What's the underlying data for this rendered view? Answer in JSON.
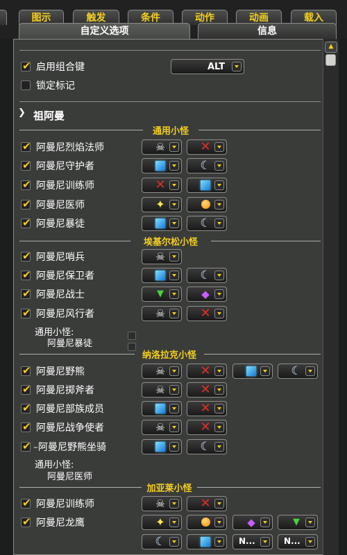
{
  "tabs_top": [
    "图示",
    "触发",
    "条件",
    "动作",
    "动画",
    "载入"
  ],
  "tabs_sub": [
    "自定义选项",
    "信息"
  ],
  "options": {
    "combo_key_label": "启用组合键",
    "combo_key_value": "ALT",
    "lock_label": "锁定标记"
  },
  "boss_name": "祖阿曼",
  "sections": {
    "s1": "通用小怪",
    "s2": "埃基尔松小怪",
    "s3": "纳洛拉克小怪",
    "s4": "加亚莱小怪"
  },
  "rows": {
    "r1": "阿曼尼烈焰法师",
    "r2": "阿曼尼守护者",
    "r3": "阿曼尼训练师",
    "r4": "阿曼尼医师",
    "r5": "阿曼尼暴徒",
    "r6": "阿曼尼哨兵",
    "r7": "阿曼尼保卫者",
    "r8": "阿曼尼战士",
    "r9": "阿曼尼风行者",
    "r10": "阿曼尼野熊",
    "r11": "阿曼尼掷斧者",
    "r12": "阿曼尼部族成员",
    "r13": "阿曼尼战争使者",
    "r14": "阿曼尼野熊坐骑",
    "r15": "阿曼尼训练师",
    "r16": "阿曼尼龙鹰"
  },
  "notes": {
    "n1_title": "通用小怪:",
    "n1_value": "阿曼尼暴徒",
    "n2_title": "通用小怪:",
    "n2_value": "阿曼尼医师"
  },
  "markers": {
    "skull": "☠",
    "cross": "✕",
    "moon": "☾",
    "star": "✦",
    "triangle": "▼",
    "diamond": "◆",
    "none": "N..."
  },
  "colors": {
    "accent": "#f4cf1e",
    "panel": "#3a3c3a"
  }
}
